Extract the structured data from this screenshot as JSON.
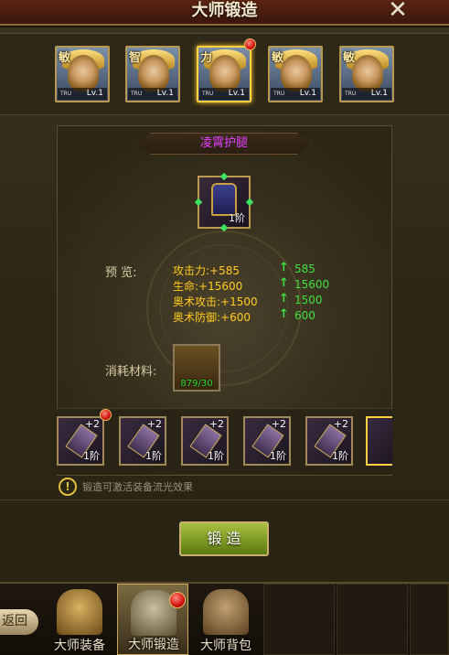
{
  "window": {
    "title": "大师锻造",
    "close_icon": "close-icon"
  },
  "heroes": [
    {
      "attr": "敏",
      "level": "Lv.1",
      "badge": "TRU",
      "selected": false,
      "red_dot": false
    },
    {
      "attr": "智",
      "level": "Lv.1",
      "badge": "TRU",
      "selected": false,
      "red_dot": false
    },
    {
      "attr": "力",
      "level": "Lv.1",
      "badge": "TRU",
      "selected": true,
      "red_dot": true
    },
    {
      "attr": "敏",
      "level": "Lv.1",
      "badge": "TRU",
      "selected": false,
      "red_dot": false
    },
    {
      "attr": "敏",
      "level": "Lv.1",
      "badge": "TRU",
      "selected": false,
      "red_dot": false
    }
  ],
  "item": {
    "name": "凌霄护腿",
    "tier": "1阶"
  },
  "preview": {
    "label": "预  览:",
    "stats": [
      {
        "name": "攻击力:+585",
        "after": "585"
      },
      {
        "name": "生命:+15600",
        "after": "15600"
      },
      {
        "name": "奥术攻击:+1500",
        "after": "1500"
      },
      {
        "name": "奥术防御:+600",
        "after": "600"
      }
    ]
  },
  "material": {
    "label": "消耗材料:",
    "count": "879/30"
  },
  "equipment_slots": [
    {
      "plus": "+2",
      "tier": "1阶",
      "red_dot": true
    },
    {
      "plus": "+2",
      "tier": "1阶",
      "red_dot": false
    },
    {
      "plus": "+2",
      "tier": "1阶",
      "red_dot": false
    },
    {
      "plus": "+2",
      "tier": "1阶",
      "red_dot": false
    },
    {
      "plus": "+2",
      "tier": "1阶",
      "red_dot": false
    },
    {
      "plus": "",
      "tier": "",
      "red_dot": false
    }
  ],
  "hint": "锻造可激活装备流光效果",
  "forge_button": "锻 造",
  "bottom_nav": {
    "back": "返回",
    "tabs": [
      {
        "label": "大师装备",
        "active": false
      },
      {
        "label": "大师锻造",
        "active": true
      },
      {
        "label": "大师背包",
        "active": false
      }
    ]
  },
  "colors": {
    "item_name": "#e040ff",
    "stat": "#ffcc20",
    "up": "#40e040",
    "accent": "#ffd040"
  }
}
